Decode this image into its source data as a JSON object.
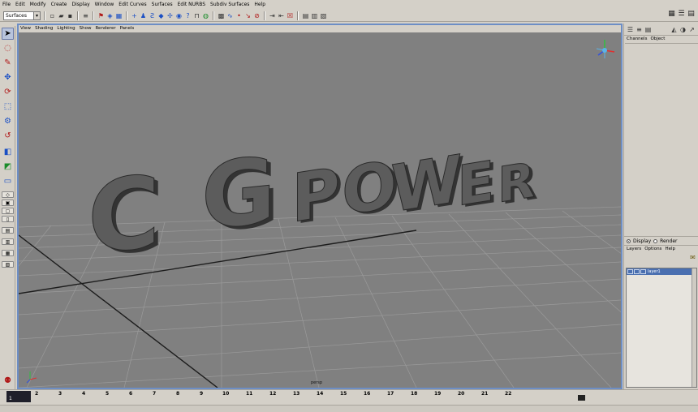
{
  "app": {
    "menubar": [
      "File",
      "Edit",
      "Modify",
      "Create",
      "Display",
      "Window",
      "Edit Curves",
      "Surfaces",
      "Edit NURBS",
      "Subdiv Surfaces",
      "Help"
    ]
  },
  "statusline": {
    "mode": "Surfaces"
  },
  "panel": {
    "menu": [
      "View",
      "Shading",
      "Lighting",
      "Show",
      "Renderer",
      "Panels"
    ],
    "camera": "persp"
  },
  "scene": {
    "text": [
      "C",
      "G",
      "P",
      "O",
      "W",
      "E",
      "R"
    ],
    "object_color": "#555555",
    "grid_color": "#9a9a9a",
    "background": "#808080"
  },
  "channelbox": {
    "tabs": [
      "Channels",
      "Object"
    ]
  },
  "layers": {
    "display_label": "Display",
    "render_label": "Render",
    "menu": [
      "Layers",
      "Options",
      "Help"
    ],
    "rows": [
      {
        "name": "layer1"
      }
    ]
  },
  "timeline": {
    "ticks": [
      "1",
      "2",
      "3",
      "4",
      "5",
      "6",
      "7",
      "8",
      "9",
      "10",
      "11",
      "12",
      "13",
      "14",
      "15",
      "16",
      "17",
      "18",
      "19",
      "20",
      "21",
      "22"
    ],
    "current_frame": "1"
  }
}
